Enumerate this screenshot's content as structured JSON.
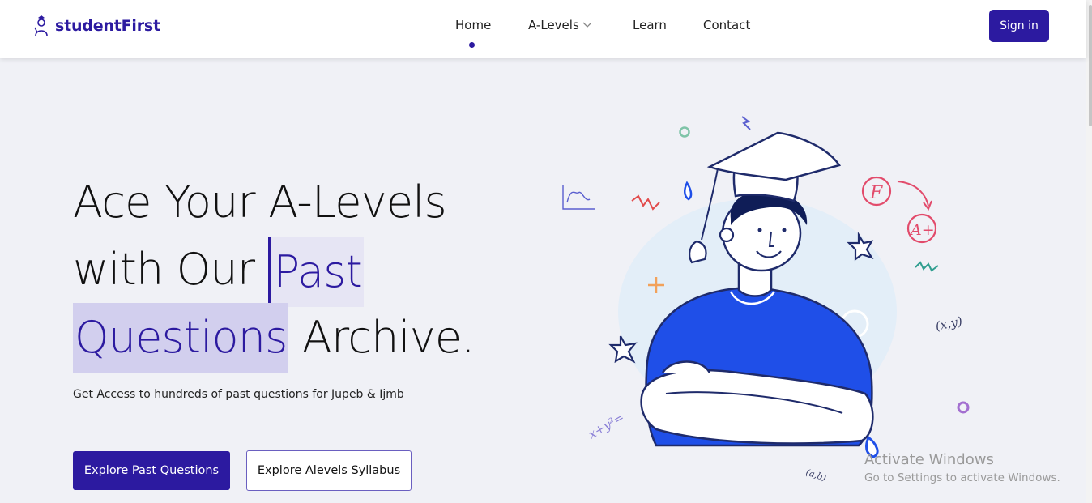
{
  "brand": {
    "name": "studentFirst",
    "color": "#2c1aa0"
  },
  "nav": {
    "items": [
      {
        "label": "Home",
        "active": true
      },
      {
        "label": "A-Levels",
        "has_dropdown": true
      },
      {
        "label": "Learn"
      },
      {
        "label": "Contact"
      }
    ],
    "signin_label": "Sign in"
  },
  "hero": {
    "line1": "Ace Your A-Levels",
    "line2_prefix": "with Our ",
    "line2_highlight": "Past",
    "line3_highlight": "Questions",
    "line3_suffix": " Archive.",
    "subtitle": "Get Access to hundreds of past questions for Jupeb & Ijmb",
    "primary_button": "Explore Past Questions",
    "secondary_button": "Explore Alevels Syllabus"
  },
  "illustration": {
    "grade_from": "F",
    "grade_to": "A+",
    "math_xy": "(x,y)",
    "math_ab": "(a,b)",
    "math_eq": "x+y²="
  },
  "watermark": {
    "title": "Activate Windows",
    "subtitle": "Go to Settings to activate Windows."
  },
  "colors": {
    "accent": "#2c1aa0",
    "background": "#f0f1f6",
    "shirt": "#1f4fe8",
    "highlight_light": "#e6e5f4",
    "highlight_dark": "#d2cfee"
  }
}
